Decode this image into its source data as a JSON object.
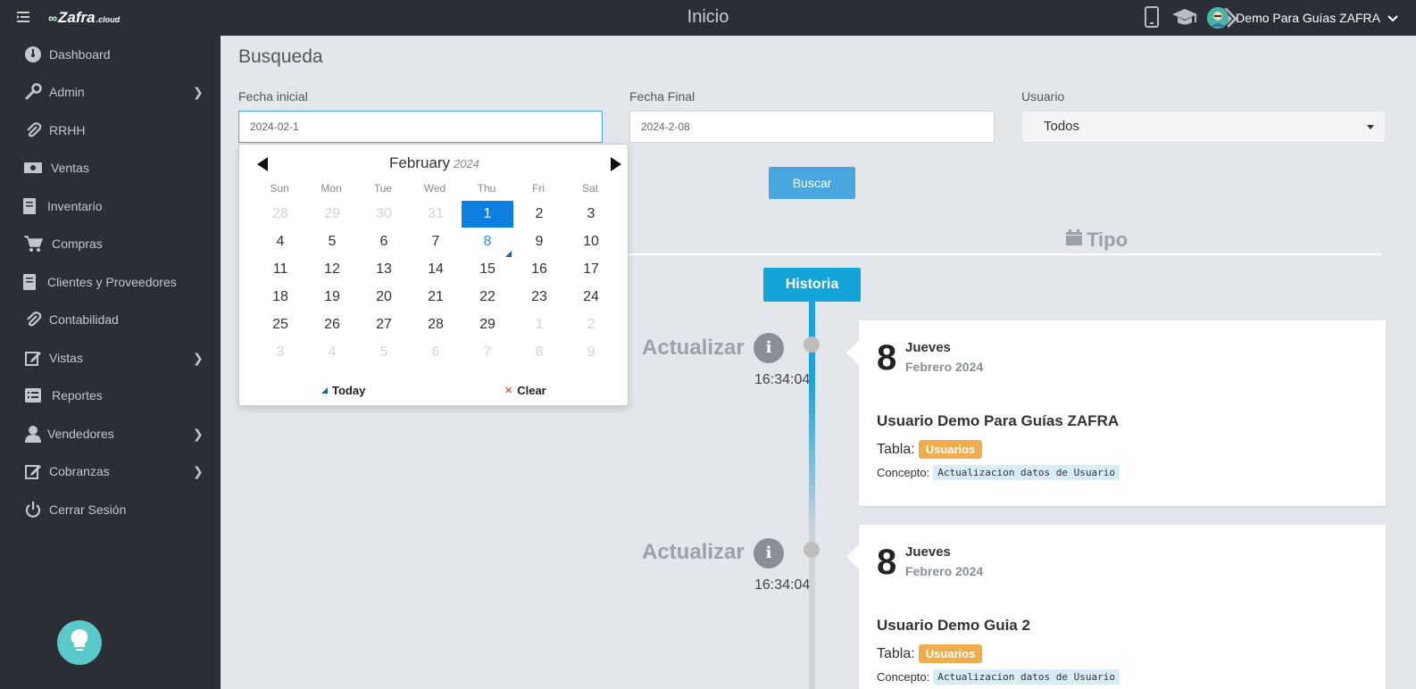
{
  "topbar": {
    "brand": "Zafra",
    "brand_suffix": ".cloud",
    "title": "Inicio",
    "icons": [
      "mobile-icon",
      "graduation-cap-icon",
      "tags-icon"
    ],
    "user_name": "Demo Para Guías ZAFRA"
  },
  "sidebar": {
    "items": [
      {
        "label": "Dashboard",
        "icon": "dashboard-icon",
        "has_submenu": false
      },
      {
        "label": "Admin",
        "icon": "wrench-icon",
        "has_submenu": true
      },
      {
        "label": "RRHH",
        "icon": "paperclip-icon",
        "has_submenu": false
      },
      {
        "label": "Ventas",
        "icon": "money-icon",
        "has_submenu": false
      },
      {
        "label": "Inventario",
        "icon": "book-icon",
        "has_submenu": false
      },
      {
        "label": "Compras",
        "icon": "cart-icon",
        "has_submenu": false
      },
      {
        "label": "Clientes y Proveedores",
        "icon": "book-icon",
        "has_submenu": false
      },
      {
        "label": "Contabilidad",
        "icon": "paperclip-icon",
        "has_submenu": false
      },
      {
        "label": "Vistas",
        "icon": "edit-icon",
        "has_submenu": true
      },
      {
        "label": "Reportes",
        "icon": "list-icon",
        "has_submenu": false
      },
      {
        "label": "Vendedores",
        "icon": "user-icon",
        "has_submenu": true
      },
      {
        "label": "Cobranzas",
        "icon": "edit-icon",
        "has_submenu": true
      },
      {
        "label": "Cerrar Sesión",
        "icon": "power-icon",
        "has_submenu": false
      }
    ]
  },
  "search": {
    "title": "Busqueda",
    "fecha_inicial_label": "Fecha inicial",
    "fecha_inicial_value": "2024-02-1",
    "fecha_final_label": "Fecha Final",
    "fecha_final_value": "2024-2-08",
    "usuario_label": "Usuario",
    "usuario_value": "Todos",
    "buscar_label": "Buscar"
  },
  "datepicker": {
    "month": "February",
    "year": "2024",
    "weekdays": [
      "Sun",
      "Mon",
      "Tue",
      "Wed",
      "Thu",
      "Fri",
      "Sat"
    ],
    "weeks": [
      [
        "28",
        "29",
        "30",
        "31",
        "1",
        "2",
        "3"
      ],
      [
        "4",
        "5",
        "6",
        "7",
        "8",
        "9",
        "10"
      ],
      [
        "11",
        "12",
        "13",
        "14",
        "15",
        "16",
        "17"
      ],
      [
        "18",
        "19",
        "20",
        "21",
        "22",
        "23",
        "24"
      ],
      [
        "25",
        "26",
        "27",
        "28",
        "29",
        "1",
        "2"
      ],
      [
        "3",
        "4",
        "5",
        "6",
        "7",
        "8",
        "9"
      ]
    ],
    "selected_day": "1",
    "today_day": "8",
    "today_label": "Today",
    "clear_label": "Clear"
  },
  "timeline": {
    "section_title": "Tipo",
    "header_label": "Historia",
    "entries": [
      {
        "action": "Actualizar",
        "time": "16:34:04",
        "day": "8",
        "weekday": "Jueves",
        "month_year": "Febrero 2024",
        "user": "Usuario Demo Para Guías ZAFRA",
        "tabla_label": "Tabla:",
        "tabla_value": "Usuarios",
        "concepto_label": "Concepto:",
        "concepto_value": "Actualizacion datos de Usuario"
      },
      {
        "action": "Actualizar",
        "time": "16:34:04",
        "day": "8",
        "weekday": "Jueves",
        "month_year": "Febrero 2024",
        "user": "Usuario Demo Guia 2",
        "tabla_label": "Tabla:",
        "tabla_value": "Usuarios",
        "concepto_label": "Concepto:",
        "concepto_value": "Actualizacion datos de Usuario"
      }
    ]
  },
  "colors": {
    "sidebar_bg": "#2b2f35",
    "page_bg": "#e3e7ec",
    "accent_blue": "#14a5d8",
    "button_blue": "#4aa6df",
    "badge_orange": "#f0ad4e",
    "selected_day": "#0d7fe1"
  }
}
